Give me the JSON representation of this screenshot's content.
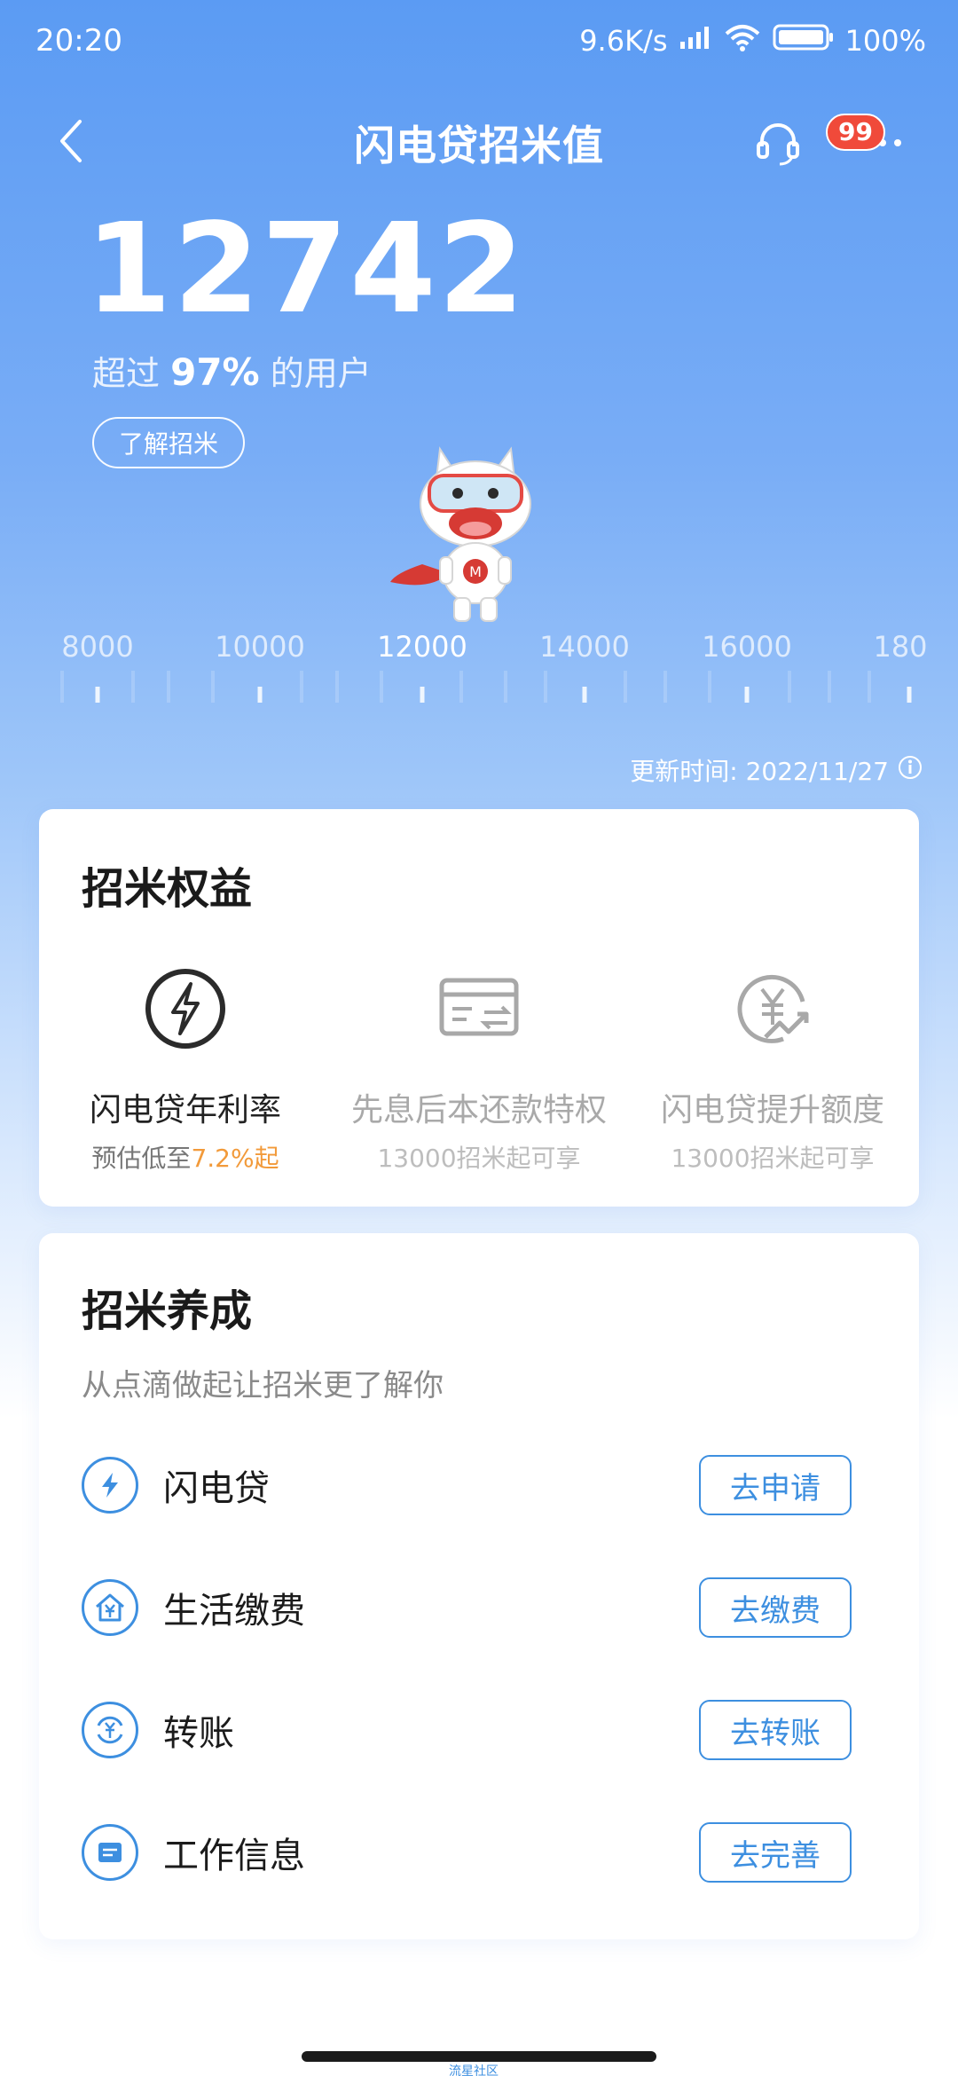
{
  "status_bar": {
    "time": "20:20",
    "speed": "9.6K/s",
    "battery": "100%"
  },
  "header": {
    "title": "闪电贷招米值",
    "badge": "99"
  },
  "score": {
    "value": "12742",
    "rank_prefix": "超过",
    "rank_value": "97%",
    "rank_suffix": "的用户",
    "learn_button": "了解招米"
  },
  "scale": {
    "labels": [
      "8000",
      "10000",
      "12000",
      "14000",
      "16000",
      "180"
    ],
    "active": "12000"
  },
  "update": {
    "text": "更新时间: 2022/11/27"
  },
  "rights": {
    "title": "招米权益",
    "items": [
      {
        "title": "闪电贷年利率",
        "sub_prefix": "预估低至",
        "sub_rate": "7.2%起",
        "icon": "lightning-icon"
      },
      {
        "title": "先息后本还款特权",
        "sub": "13000招米起可享",
        "icon": "card-transfer-icon"
      },
      {
        "title": "闪电贷提升额度",
        "sub": "13000招米起可享",
        "icon": "yen-up-icon"
      }
    ]
  },
  "grow": {
    "title": "招米养成",
    "subtitle": "从点滴做起让招米更了解你",
    "tasks": [
      {
        "label": "闪电贷",
        "button": "去申请",
        "icon": "lightning-icon"
      },
      {
        "label": "生活缴费",
        "button": "去缴费",
        "icon": "house-yen-icon"
      },
      {
        "label": "转账",
        "button": "去转账",
        "icon": "transfer-yen-icon"
      },
      {
        "label": "工作信息",
        "button": "去完善",
        "icon": "id-card-icon"
      }
    ]
  },
  "footer": {
    "watermark": "流星社区"
  },
  "colors": {
    "primary": "#3d8fe0",
    "accent": "#f29a3a",
    "badge": "#f04a3a"
  }
}
